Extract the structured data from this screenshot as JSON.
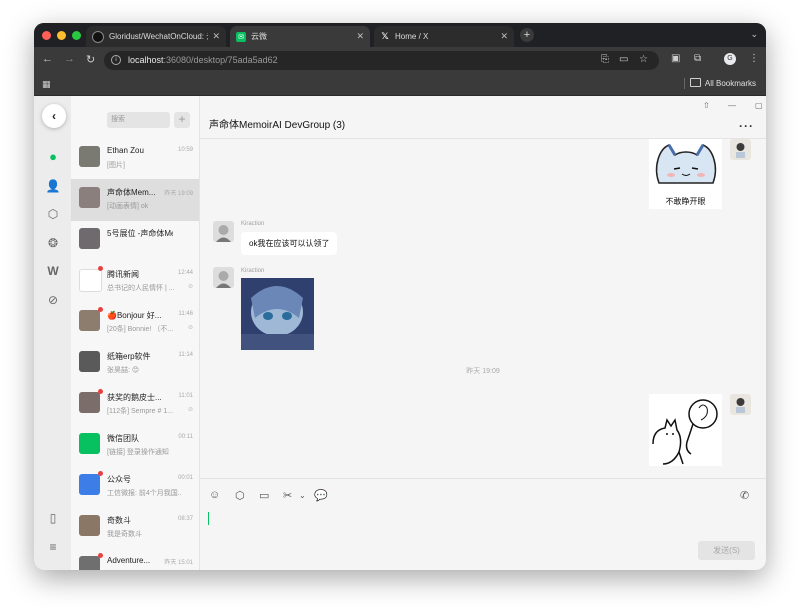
{
  "browser": {
    "tabs": [
      {
        "title": "Gloridust/WechatOnCloud: 云",
        "icon": "github-icon"
      },
      {
        "title": "云微",
        "icon": "wechat-favicon"
      },
      {
        "title": "Home / X",
        "icon": "x-logo-icon"
      }
    ],
    "url_host": "localhost",
    "url_rest": ":36080/desktop/75ada5ad62",
    "bookmarks_label": "All Bookmarks",
    "profile_initial": "G"
  },
  "app": {
    "search_placeholder": "搜索",
    "add_label": "+",
    "chats": [
      {
        "name": "Ethan Zou",
        "time": "10:59",
        "preview": "[图片]",
        "unread": false,
        "muted": "",
        "selected": false,
        "avatar": "#7a7a72"
      },
      {
        "name": "声命体Mem...",
        "time": "昨天 19:09",
        "preview": "[动画表情] ok",
        "unread": false,
        "muted": "",
        "selected": true,
        "avatar": "#8a7f7c"
      },
      {
        "name": "5号展位 -声命体Me...",
        "time": "",
        "preview": "",
        "unread": false,
        "muted": "",
        "selected": false,
        "avatar": "#6e6a6d"
      },
      {
        "name": "腾讯新闻",
        "time": "12:44",
        "preview": "总书记的人民情怀 | ...",
        "unread": true,
        "muted": "⊘",
        "selected": false,
        "avatar": "#ffffff"
      },
      {
        "name": "🍎Bonjour 好...",
        "time": "11:46",
        "preview": "[20条] Bonnie! （不...",
        "unread": true,
        "muted": "⊘",
        "selected": false,
        "avatar": "#8c7d6e"
      },
      {
        "name": "纸箱erp软件",
        "time": "11:14",
        "preview": "张昊喆: 😊",
        "unread": false,
        "muted": "",
        "selected": false,
        "avatar": "#5a5a5a"
      },
      {
        "name": "获奖的鹅皮士...",
        "time": "11:01",
        "preview": "[112条] Sempre # 1...",
        "unread": true,
        "muted": "⊘",
        "selected": false,
        "avatar": "#7b6d6a"
      },
      {
        "name": "微信团队",
        "time": "00:11",
        "preview": "[链接] 登录操作通知",
        "unread": false,
        "muted": "",
        "selected": false,
        "avatar": "#07c160"
      },
      {
        "name": "公众号",
        "time": "00:01",
        "preview": "工信微报: 前4个月我国...",
        "unread": true,
        "muted": "",
        "selected": false,
        "avatar": "#3d7de8"
      },
      {
        "name": "奇数斗",
        "time": "08:37",
        "preview": "我是奇数斗",
        "unread": false,
        "muted": "",
        "selected": false,
        "avatar": "#8a7766"
      },
      {
        "name": "Adventure...",
        "time": "昨天 15:01",
        "preview": "",
        "unread": true,
        "muted": "",
        "selected": false,
        "avatar": "#6f6f6f"
      }
    ],
    "conversation": {
      "title": "声命体MemoirAI DevGroup (3)",
      "messages": {
        "sticker_caption": "不敢睁开眼",
        "sender1": "Kiraction",
        "text1": "ok我在应该可以认领了",
        "sender2": "Kiraction",
        "timestamp": "昨天 19:09"
      },
      "send_label": "发送(S)"
    }
  }
}
